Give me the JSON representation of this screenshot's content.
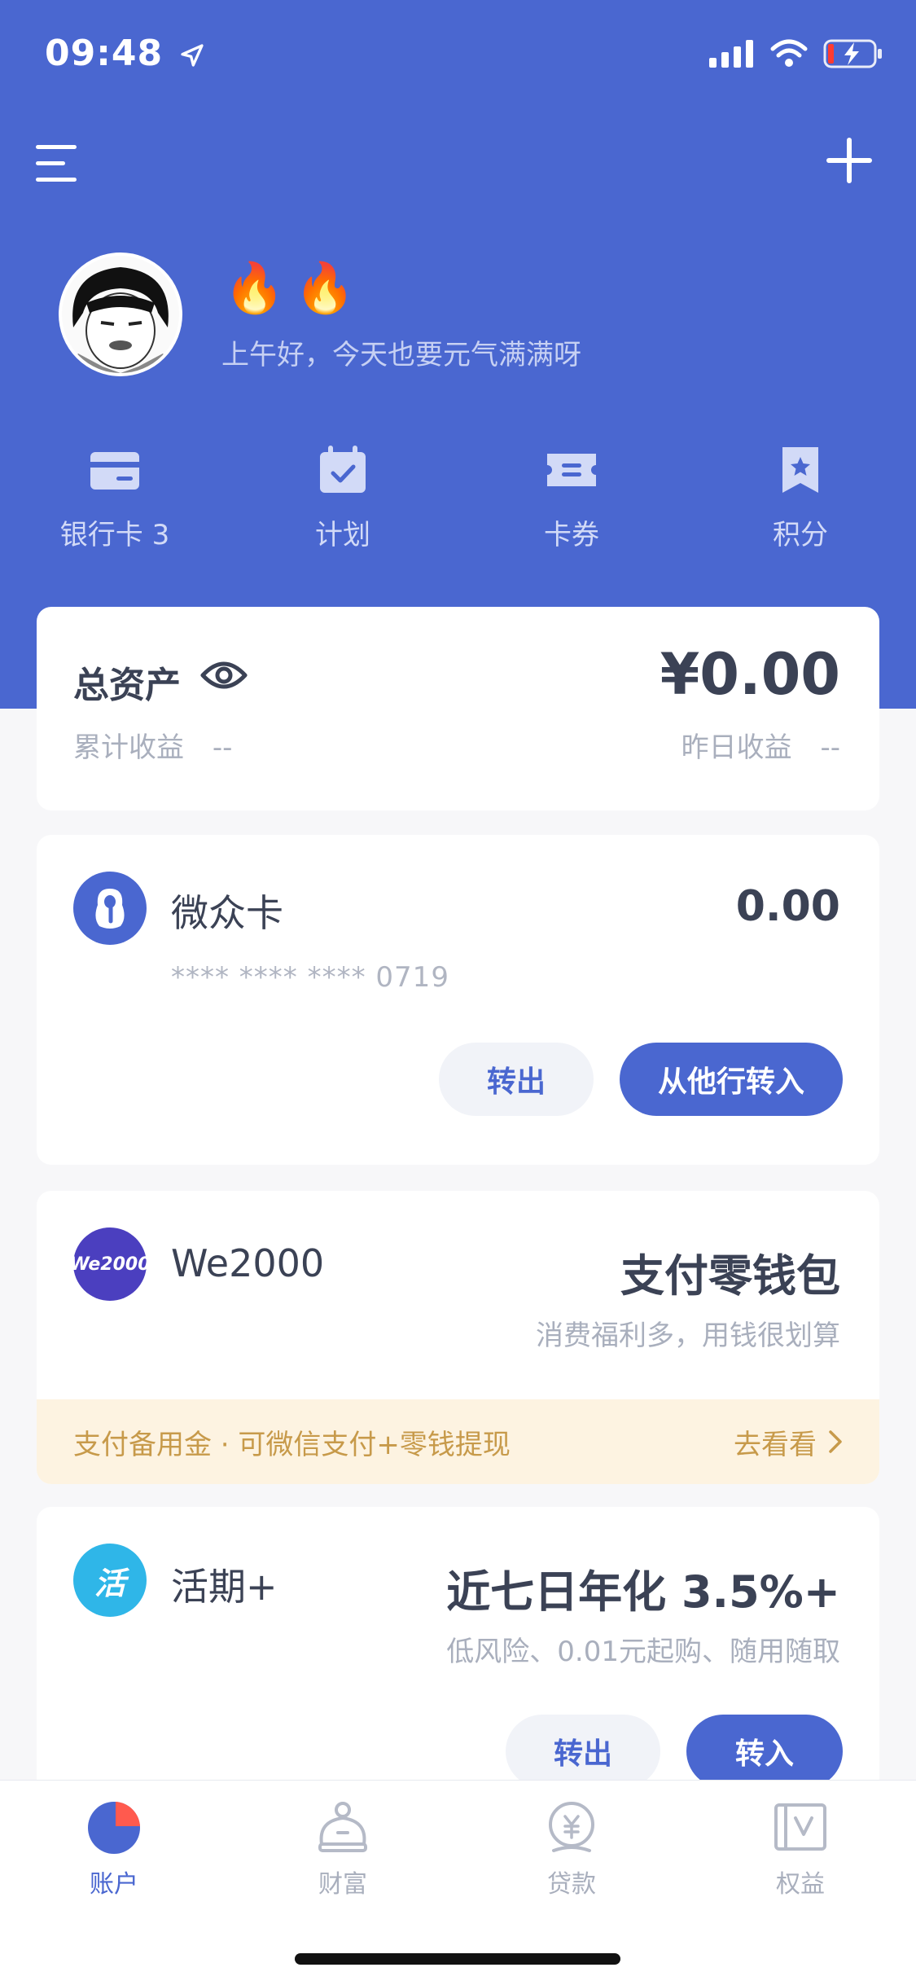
{
  "status": {
    "time": "09:48"
  },
  "header": {
    "greeting": "上午好，今天也要元气满满呀",
    "fires": "🔥🔥"
  },
  "quick_actions": [
    {
      "label": "银行卡 3",
      "icon": "bank-card-icon"
    },
    {
      "label": "计划",
      "icon": "calendar-check-icon"
    },
    {
      "label": "卡券",
      "icon": "ticket-icon"
    },
    {
      "label": "积分",
      "icon": "bookmark-star-icon"
    }
  ],
  "total": {
    "label": "总资产",
    "value": "¥0.00",
    "cumulative_label": "累计收益",
    "cumulative_value": "--",
    "yesterday_label": "昨日收益",
    "yesterday_value": "--"
  },
  "weizhong_card": {
    "name": "微众卡",
    "amount": "0.00",
    "card_number": "**** **** **** 0719",
    "btn_out": "转出",
    "btn_in": "从他行转入"
  },
  "we2000": {
    "name": "We2000",
    "logo_text": "We2000",
    "headline": "支付零钱包",
    "sub": "消费福利多，用钱很划算",
    "promo_text": "支付备用金 · 可微信支付+零钱提现",
    "promo_link": "去看看"
  },
  "huoqi": {
    "name": "活期+",
    "logo_text": "活",
    "headline": "近七日年化 3.5%+",
    "sub": "低风险、0.01元起购、随用随取",
    "btn_out": "转出",
    "btn_in": "转入"
  },
  "tabbar": [
    {
      "label": "账户",
      "active": true
    },
    {
      "label": "财富",
      "active": false
    },
    {
      "label": "贷款",
      "active": false
    },
    {
      "label": "权益",
      "active": false
    }
  ],
  "colors": {
    "primary": "#4a67d0",
    "promo_bg": "#fdf3e1",
    "promo_text": "#c79a4a"
  }
}
